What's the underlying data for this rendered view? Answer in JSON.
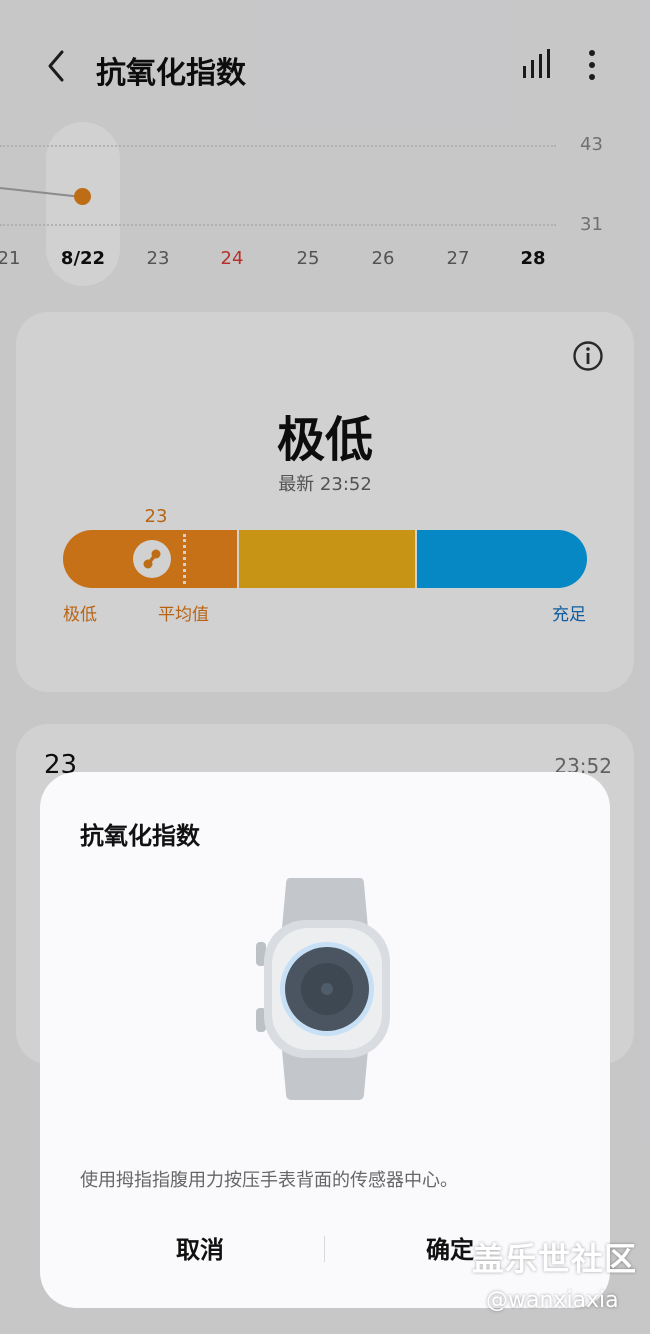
{
  "header": {
    "title": "抗氧化指数",
    "back_icon": "chevron-left-icon",
    "stats_icon": "bar-chart-icon",
    "more_icon": "more-vertical-icon"
  },
  "timeline": {
    "y_labels": [
      "43",
      "31"
    ],
    "dates": [
      "21",
      "8/22",
      "23",
      "24",
      "25",
      "26",
      "27",
      "28"
    ],
    "selected_date": "8/22",
    "highlight_date": "24",
    "point_value": 23
  },
  "summary_card": {
    "info_icon": "info-icon",
    "level": "极低",
    "latest": "最新 23:52",
    "value": "23",
    "labels": {
      "low": "极低",
      "average": "平均值",
      "high": "充足"
    },
    "colors": {
      "low": "#f28a1e",
      "mid": "#f3b51b",
      "high": "#08a6f0"
    }
  },
  "detail_card": {
    "value": "23",
    "time": "23:52"
  },
  "dialog": {
    "title": "抗氧化指数",
    "illustration": "smartwatch-icon",
    "instruction": "使用拇指指腹用力按压手表背面的传感器中心。",
    "cancel_label": "取消",
    "confirm_label": "确定"
  },
  "watermark": {
    "logo": "盖乐世社区",
    "handle": "@wanxiaxia"
  }
}
